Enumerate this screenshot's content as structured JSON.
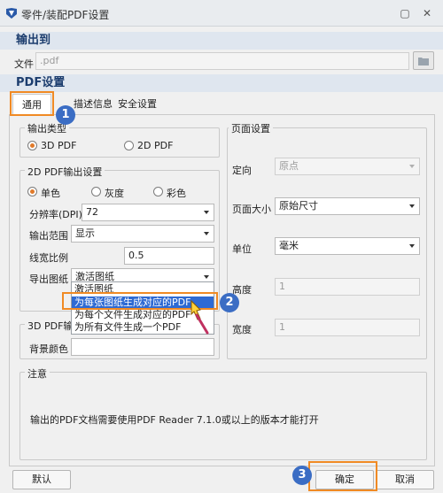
{
  "window": {
    "title": "零件/装配PDF设置"
  },
  "output_section": {
    "heading": "输出到",
    "file_label": "文件",
    "file_value": ".pdf"
  },
  "pdf_section": {
    "heading": "PDF设置"
  },
  "tabs": [
    {
      "label": "通用"
    },
    {
      "label": "描述信息"
    },
    {
      "label": "安全设置"
    }
  ],
  "output_type": {
    "title": "输出类型",
    "options": [
      {
        "label": "3D PDF",
        "selected": true
      },
      {
        "label": "2D PDF",
        "selected": false
      }
    ]
  },
  "pdf2d": {
    "title": "2D PDF输出设置",
    "color_options": [
      {
        "label": "单色",
        "selected": true
      },
      {
        "label": "灰度",
        "selected": false
      },
      {
        "label": "彩色",
        "selected": false
      }
    ],
    "resolution_label": "分辨率(DPI)",
    "resolution_value": "72",
    "range_label": "输出范围",
    "range_value": "显示",
    "line_ratio_label": "线宽比例",
    "line_ratio_value": "0.5",
    "export_label": "导出图纸",
    "export_value": "激活图纸",
    "export_options": [
      "激活图纸",
      "为每张图纸生成对应的PDF",
      "为每个文件生成对应的PDF",
      "为所有文件生成一个PDF"
    ],
    "highlighted_option_index": 1
  },
  "pdf3d": {
    "title": "3D PDF输出",
    "bg_color_label": "背景颜色"
  },
  "page_settings": {
    "title": "页面设置",
    "orientation_label": "定向",
    "orientation_value": "原点",
    "page_size_label": "页面大小",
    "page_size_value": "原始尺寸",
    "unit_label": "单位",
    "unit_value": "毫米",
    "height_label": "高度",
    "height_value": "1",
    "width_label": "宽度",
    "width_value": "1"
  },
  "note": {
    "title": "注意",
    "text": "输出的PDF文档需要使用PDF Reader 7.1.0或以上的版本才能打开"
  },
  "buttons": {
    "default": "默认",
    "ok": "确定",
    "cancel": "取消"
  },
  "annotations": {
    "badge1": "1",
    "badge2": "2",
    "badge3": "3"
  },
  "colors": {
    "highlight_orange": "#f08a24",
    "badge_blue": "#3b6dc4",
    "selection_blue": "#2e6ad3",
    "radio_accent": "#e07a2a"
  }
}
